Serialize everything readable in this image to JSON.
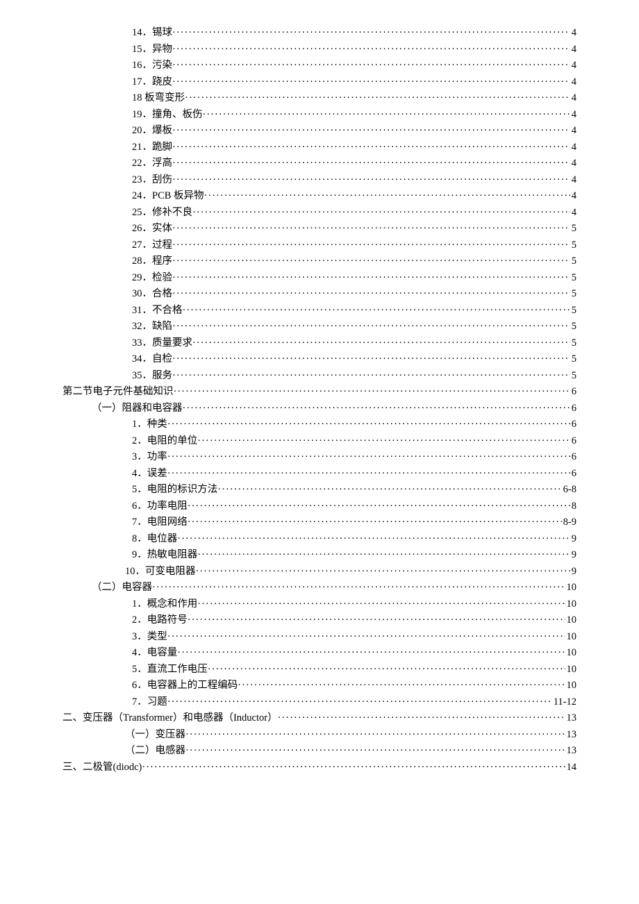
{
  "toc": [
    {
      "indent": "indent-3",
      "label": "14．锡球",
      "page": "4"
    },
    {
      "indent": "indent-3",
      "label": "15．异物",
      "page": "4"
    },
    {
      "indent": "indent-3",
      "label": "16．污染",
      "page": "4"
    },
    {
      "indent": "indent-3",
      "label": "17．跷皮 ",
      "page": "4"
    },
    {
      "indent": "indent-3",
      "label": "18 板弯变形",
      "page": "4"
    },
    {
      "indent": "indent-3",
      "label": "19．撞角、板伤",
      "page": "4"
    },
    {
      "indent": "indent-3",
      "label": "20．爆板",
      "page": "4"
    },
    {
      "indent": "indent-3",
      "label": "21．跪脚 ",
      "page": "4"
    },
    {
      "indent": "indent-3",
      "label": "22．浮高",
      "page": "4"
    },
    {
      "indent": "indent-3",
      "label": "23．刮伤 ",
      "page": "4"
    },
    {
      "indent": "indent-3",
      "label": "24．PCB 板异物  ",
      "page": "4"
    },
    {
      "indent": "indent-3",
      "label": "25．修补不良  ",
      "page": "4"
    },
    {
      "indent": "indent-3",
      "label": "26．实体 ",
      "page": "5"
    },
    {
      "indent": "indent-3",
      "label": "27．过程 ",
      "page": "5"
    },
    {
      "indent": "indent-3",
      "label": "28．程序 ",
      "page": "5"
    },
    {
      "indent": "indent-3",
      "label": "29．检验 ",
      "page": "5"
    },
    {
      "indent": "indent-3",
      "label": "30．合格 ",
      "page": "5"
    },
    {
      "indent": "indent-3",
      "label": "31．不合格",
      "page": "5"
    },
    {
      "indent": "indent-3",
      "label": "32．缺陷 ",
      "page": "5"
    },
    {
      "indent": "indent-3",
      "label": "33．质量要求 ",
      "page": "5"
    },
    {
      "indent": "indent-3",
      "label": "34．自检 ",
      "page": "5"
    },
    {
      "indent": "indent-3",
      "label": "35．服务 ",
      "page": "5"
    },
    {
      "indent": "indent-1",
      "label": "第二节电子元件基础知识",
      "page": " 6"
    },
    {
      "indent": "indent-2",
      "label": "（一）阻器和电容器",
      "page": "6"
    },
    {
      "indent": "indent-3",
      "label": "1．种类",
      "page": "6"
    },
    {
      "indent": "indent-3",
      "label": "2．电阻的单位 ",
      "page": "6"
    },
    {
      "indent": "indent-3",
      "label": "3．功率",
      "page": "6"
    },
    {
      "indent": "indent-3",
      "label": "4．误差",
      "page": "6"
    },
    {
      "indent": "indent-3",
      "label": "5．电阻的标识方法 ",
      "page": "6-8"
    },
    {
      "indent": "indent-3",
      "label": "6．功率电阻 ",
      "page": "8"
    },
    {
      "indent": "indent-3",
      "label": "7．电阻网络 ",
      "page": "8-9"
    },
    {
      "indent": "indent-3",
      "label": "8．电位器 ",
      "page": "9"
    },
    {
      "indent": "indent-3",
      "label": "9．热敏电阻器 ",
      "page": "9"
    },
    {
      "indent": "indent-3b",
      "label": "10．可变电阻器",
      "page": "9"
    },
    {
      "indent": "indent-2",
      "label": "（二）电容器",
      "page": "10"
    },
    {
      "indent": "indent-3",
      "label": "1．概念和作用 ",
      "page": "10"
    },
    {
      "indent": "indent-3",
      "label": "2．电路符号 ",
      "page": "10"
    },
    {
      "indent": "indent-3",
      "label": "3．类型",
      "page": "10"
    },
    {
      "indent": "indent-3",
      "label": "4．电容量 ",
      "page": "10"
    },
    {
      "indent": "indent-3",
      "label": "5．直流工作电压",
      "page": "10"
    },
    {
      "indent": "indent-3",
      "label": "6．电容器上的工程编码",
      "page": "10"
    },
    {
      "indent": "indent-3",
      "label": "7．习题",
      "page": " 11-12"
    },
    {
      "indent": "indent-1",
      "label": "二、变压器（Transformer）和电感器（Inductor） ",
      "page": "13"
    },
    {
      "indent": "indent-3b",
      "label": "（一）变压器",
      "page": "13"
    },
    {
      "indent": "indent-3b",
      "label": "（二）电感器",
      "page": "13"
    },
    {
      "indent": "indent-1",
      "label": "三、二极管(diodc)",
      "page": "14"
    }
  ]
}
